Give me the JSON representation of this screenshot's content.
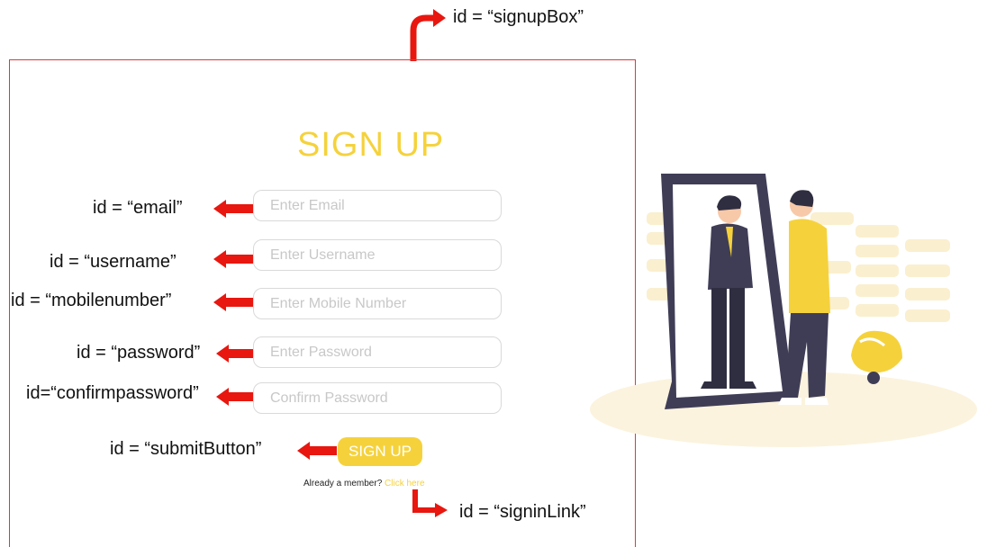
{
  "form": {
    "title": "SIGN UP",
    "email_placeholder": "Enter Email",
    "username_placeholder": "Enter Username",
    "mobile_placeholder": "Enter Mobile Number",
    "password_placeholder": "Enter Password",
    "confirm_placeholder": "Confirm Password",
    "submit_label": "SIGN UP",
    "member_text": "Already a member?",
    "signin_link_label": "Click here"
  },
  "annotations": {
    "signup_box": "id = “signupBox”",
    "email": "id = “email”",
    "username": "id = “username”",
    "mobilenumber": "id = “mobilenumber”",
    "password": "id = “password”",
    "confirmpassword": "id=“confirmpassword”",
    "submit_button": "id = “submitButton”",
    "signin_link": "id = “signinLink”"
  },
  "colors": {
    "accent": "#f5d23c",
    "frame": "#d9393d",
    "arrow": "#e8170f"
  },
  "illustration": "person-looking-in-mirror"
}
